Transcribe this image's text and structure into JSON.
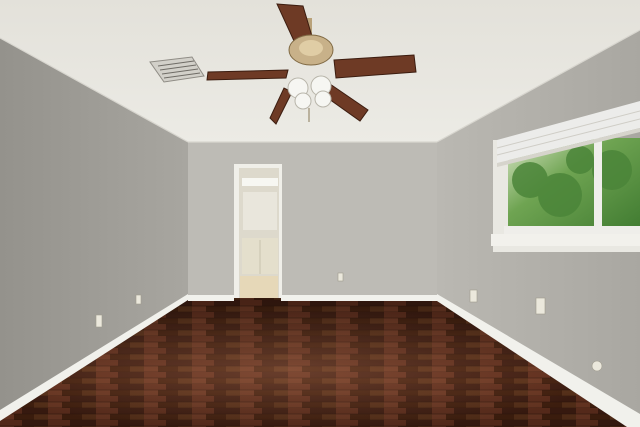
{
  "scene": {
    "kind": "photo",
    "subject": "empty room",
    "colors": {
      "ceiling": "#e9e7e1",
      "wall_left": "#9c9a94",
      "wall_back": "#bdbbb5",
      "wall_right": "#b2b0aa",
      "trim": "#f1f1ec",
      "floor_dark": "#3e1e13",
      "floor_mid": "#5a2c1c",
      "floor_light": "#7a4632",
      "fan_blade": "#6e3a25",
      "fan_metal": "#b9a27a",
      "foliage": "#4f8a3c"
    },
    "icons": [
      "ceiling-fan-icon",
      "air-vent-icon",
      "window-icon",
      "window-blind-icon",
      "doorway-icon",
      "wall-outlet-icon"
    ]
  }
}
